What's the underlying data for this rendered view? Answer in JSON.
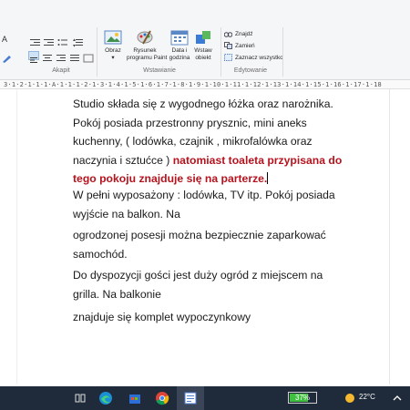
{
  "ribbon": {
    "groups": {
      "font_label": "Akapit",
      "insert_label": "Wstawianie",
      "edit_label": "Edytowanie"
    },
    "buttons": {
      "image": "Obraz",
      "paint_line1": "Rysunek",
      "paint_line2": "programu Paint",
      "datetime_line1": "Data i",
      "datetime_line2": "godzina",
      "object_line1": "Wstaw",
      "object_line2": "obiekt",
      "find": "Znajdź",
      "replace": "Zamień",
      "select_all": "Zaznacz wszystko"
    }
  },
  "ruler": {
    "text": "3·1·2·1·1·1·A·1·1·1·2·1·3·1·4·1·5·1·6·1·7·1·8·1·9·1·10·1·11·1·12·1·13·1·14·1·15·1·16·1·17·1·18"
  },
  "document": {
    "p1_normal": "Studio składa się z wygodnego łóżka oraz narożnika. Pokój posiada przestronny prysznic, mini aneks kuchenny, ( lodówka, czajnik , mikrofalówka oraz naczynia i sztućce ) ",
    "p1_red": "natomiast toaleta przypisana do tego pokoju znajduje się na parterze.",
    "p2": "W pełni wyposażony : lodówka, TV itp. Pokój posiada wyjście na balkon. Na",
    "p3": "ogrodzonej posesji można bezpiecznie zaparkować samochód.",
    "p4": "Do dyspozycji gości jest duży ogród z miejscem na grilla. Na balkonie",
    "p5": "znajduje się komplet wypoczynkowy"
  },
  "taskbar": {
    "battery": "37%",
    "temperature": "22°C"
  },
  "colors": {
    "highlight_text": "#b5141e",
    "taskbar": "#1f2b3a",
    "battery": "#3fbf3f"
  }
}
